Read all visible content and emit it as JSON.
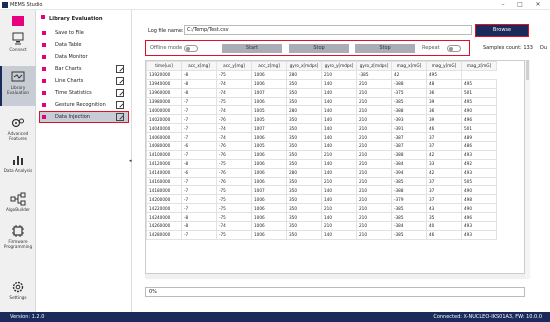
{
  "window": {
    "title": "MEMS Studio",
    "controls": [
      "–",
      "□",
      "✕"
    ]
  },
  "nav": [
    {
      "label": "Connect",
      "icon": "connect-icon"
    },
    {
      "label": "Library Evaluation",
      "icon": "library-evaluation-icon"
    },
    {
      "label": "Advanced Features",
      "icon": "advanced-features-icon"
    },
    {
      "label": "Data Analysis",
      "icon": "data-analysis-icon"
    },
    {
      "label": "AlgoBuilder",
      "icon": "algobuilder-icon"
    },
    {
      "label": "Firmware Programming",
      "icon": "firmware-programming-icon"
    },
    {
      "label": "Settings",
      "icon": "settings-icon"
    }
  ],
  "submenu": {
    "title": "Library Evaluation",
    "items": [
      {
        "label": "Save to File"
      },
      {
        "label": "Data Table"
      },
      {
        "label": "Data Monitor"
      },
      {
        "label": "Bar Charts"
      },
      {
        "label": "Line Charts"
      },
      {
        "label": "Time Statistics"
      },
      {
        "label": "Gesture Recognition"
      },
      {
        "label": "Data Injection"
      }
    ],
    "collapse_glyph": "◂"
  },
  "log": {
    "label": "Log file name:",
    "value": "C:/Temp/Test.csv",
    "browse": "Browse"
  },
  "controls": {
    "offline": "Offline mode",
    "start": "Start",
    "stop1": "Stop",
    "stop2": "Stop",
    "repeat": "Repeat"
  },
  "samples": {
    "label": "Samples count:",
    "value": "133",
    "extra": "Du"
  },
  "table": {
    "headers": [
      "time[us]",
      "acc_x[mg]",
      "acc_y[mg]",
      "acc_z[mg]",
      "gyro_x[mdps]",
      "gyro_y[mdps]",
      "gyro_z[mdps]",
      "mag_x[mG]",
      "mag_y[mG]",
      "mag_z[mG]"
    ],
    "rows": [
      [
        "13920000",
        "-8",
        "-75",
        "1006",
        "280",
        "210",
        "-385",
        "42",
        "495"
      ],
      [
        "13940000",
        "-8",
        "-74",
        "1006",
        "350",
        "140",
        "210",
        "-388",
        "48",
        "495"
      ],
      [
        "13960000",
        "-8",
        "-74",
        "1007",
        "350",
        "140",
        "210",
        "-375",
        "36",
        "501"
      ],
      [
        "13980000",
        "-7",
        "-75",
        "1006",
        "350",
        "140",
        "210",
        "-385",
        "39",
        "495"
      ],
      [
        "14000000",
        "-7",
        "-74",
        "1005",
        "280",
        "140",
        "210",
        "-388",
        "36",
        "490"
      ],
      [
        "14020000",
        "-7",
        "-76",
        "1005",
        "350",
        "140",
        "210",
        "-393",
        "39",
        "496"
      ],
      [
        "14040000",
        "-7",
        "-74",
        "1007",
        "350",
        "140",
        "210",
        "-391",
        "46",
        "501"
      ],
      [
        "14060000",
        "-7",
        "-74",
        "1006",
        "350",
        "140",
        "210",
        "-387",
        "37",
        "489"
      ],
      [
        "14080000",
        "-6",
        "-76",
        "1005",
        "350",
        "140",
        "210",
        "-387",
        "37",
        "486"
      ],
      [
        "14100000",
        "-7",
        "-76",
        "1006",
        "350",
        "210",
        "210",
        "-388",
        "42",
        "493"
      ],
      [
        "14120000",
        "-8",
        "-75",
        "1006",
        "350",
        "140",
        "210",
        "-384",
        "33",
        "492"
      ],
      [
        "14140000",
        "-6",
        "-76",
        "1006",
        "280",
        "140",
        "210",
        "-394",
        "42",
        "493"
      ],
      [
        "14160000",
        "-7",
        "-76",
        "1006",
        "350",
        "210",
        "210",
        "-385",
        "37",
        "505"
      ],
      [
        "14180000",
        "-7",
        "-75",
        "1007",
        "350",
        "140",
        "210",
        "-388",
        "37",
        "490"
      ],
      [
        "14200000",
        "-7",
        "-75",
        "1006",
        "350",
        "140",
        "210",
        "-379",
        "37",
        "498"
      ],
      [
        "14220000",
        "-7",
        "-75",
        "1006",
        "350",
        "210",
        "210",
        "-385",
        "43",
        "490"
      ],
      [
        "14240000",
        "-8",
        "-75",
        "1006",
        "350",
        "140",
        "210",
        "-385",
        "35",
        "496"
      ],
      [
        "14260000",
        "-8",
        "-74",
        "1006",
        "350",
        "210",
        "210",
        "-384",
        "40",
        "493"
      ],
      [
        "14280000",
        "-7",
        "-75",
        "1006",
        "350",
        "140",
        "210",
        "-385",
        "46",
        "493"
      ]
    ]
  },
  "progress": {
    "value": "0%"
  },
  "status": {
    "version": "Version: 1.2.0",
    "connection": "Connected:  X-NUCLEO-IKS01A3, FW: 10.0.0"
  },
  "colors": {
    "accent": "#e6007e",
    "navy": "#1a2a5a",
    "highlight": "#e0102a"
  }
}
